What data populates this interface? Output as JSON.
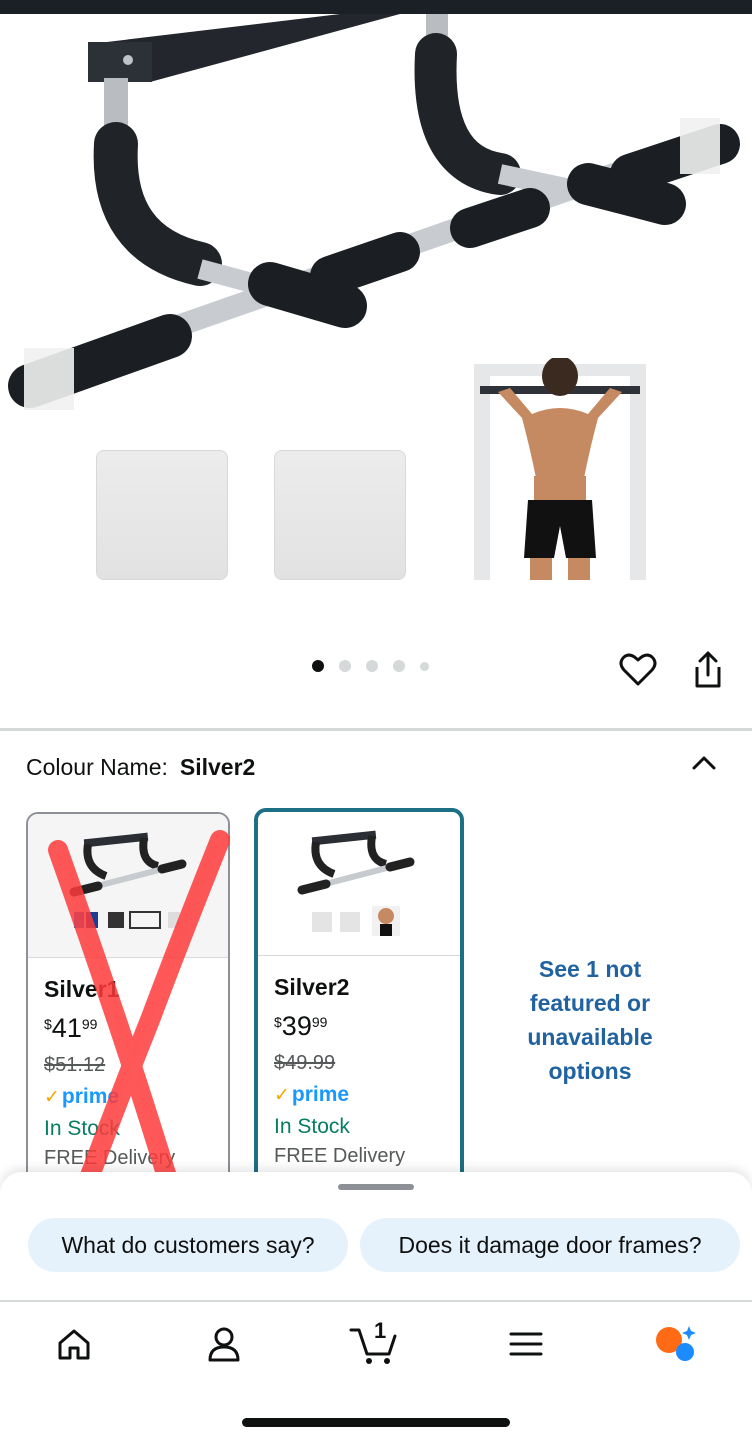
{
  "colors": {
    "teal_selected": "#1d6f85",
    "link_blue": "#2162a1",
    "in_stock_green": "#067d62",
    "prime_blue": "#1a98ff",
    "chip_bg": "#e6f2fb",
    "scribble_red": "#ff3b3b"
  },
  "gallery": {
    "images": [
      "pull-up-bar-main",
      "door-frame-demo"
    ],
    "active_index": 0,
    "dot_count": 5,
    "actions": [
      "heart-icon",
      "share-icon"
    ]
  },
  "colour": {
    "label": "Colour Name:",
    "selected": "Silver2",
    "collapse_icon": "chevron-up-icon"
  },
  "variants": [
    {
      "name": "Silver1",
      "currency": "$",
      "whole": "41",
      "fraction": "99",
      "old_price": "$51.12",
      "prime": "prime",
      "stock": "In Stock",
      "delivery": "FREE Delivery",
      "crossed_out": true
    },
    {
      "name": "Silver2",
      "currency": "$",
      "whole": "39",
      "fraction": "99",
      "old_price": "$49.99",
      "prime": "prime",
      "stock": "In Stock",
      "delivery": "FREE Delivery",
      "selected": true
    }
  ],
  "see_more": "See 1 not featured or unavailable options",
  "sheet": {
    "chips": [
      "What do customers say?",
      "Does it damage door frames?"
    ]
  },
  "nav": {
    "items": [
      "home-icon",
      "account-icon",
      "cart-icon",
      "menu-icon",
      "rufus-icon"
    ],
    "cart_count": "1"
  }
}
